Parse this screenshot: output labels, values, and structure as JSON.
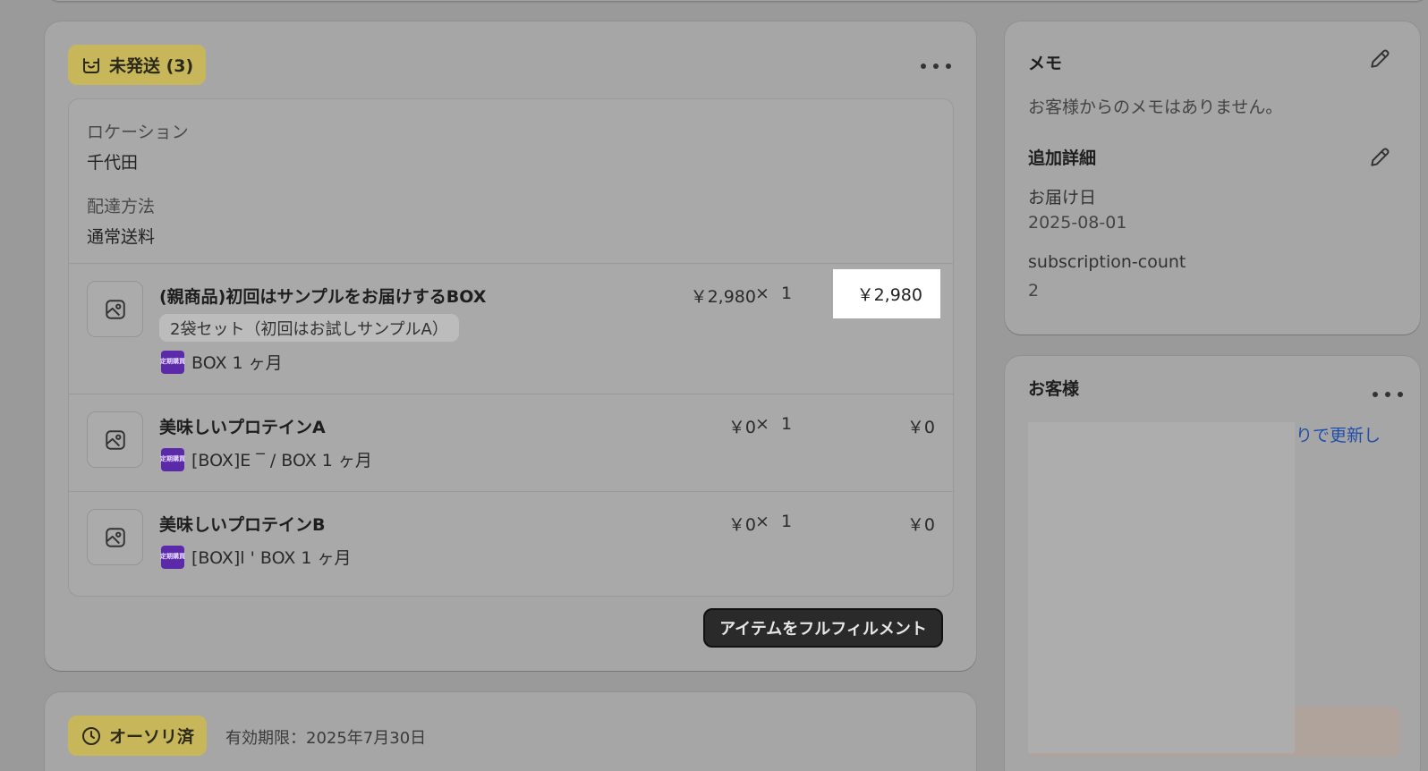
{
  "unfulfilled": {
    "badge_label": "未発送 (3)",
    "location_label": "ロケーション",
    "location_value": "千代田",
    "delivery_label": "配達方法",
    "delivery_value": "通常送料",
    "items": [
      {
        "title": "(親商品)初回はサンプルをお届けするBOX",
        "variant": "2袋セット（初回はお試しサンプルA）",
        "subscription": "BOX 1 ヶ月",
        "unit_price": "￥2,980",
        "times": "×",
        "quantity": "1",
        "total": "￥2,980"
      },
      {
        "title": "美味しいプロテインA",
        "subscription": "[BOX]E ‾  /  BOX 1 ヶ月",
        "unit_price": "￥0",
        "times": "×",
        "quantity": "1",
        "total": "￥0"
      },
      {
        "title": "美味しいプロテインB",
        "subscription": "[BOX]l     '  BOX 1 ヶ月",
        "unit_price": "￥0",
        "times": "×",
        "quantity": "1",
        "total": "￥0"
      }
    ],
    "subscription_icon_text": "定期購買",
    "fulfill_button": "アイテムをフルフィルメント"
  },
  "authorization": {
    "badge_label": "オーソリ済",
    "expiry": "有効期限：2025年7月30日"
  },
  "memo": {
    "title": "メモ",
    "empty_text": "お客様からのメモはありません。",
    "details_title": "追加詳細",
    "delivery_date_label": "お届け日",
    "delivery_date_value": "2025-08-01",
    "sub_count_label": "subscription-count",
    "sub_count_value": "2"
  },
  "customer": {
    "title": "お客様",
    "link_text": "りで更新し"
  },
  "colors": {
    "badge_bg": "#c8b75a",
    "button_bg": "#2a2a2a",
    "link": "#1f4fa8",
    "subscription_icon": "#5b2aa8"
  }
}
